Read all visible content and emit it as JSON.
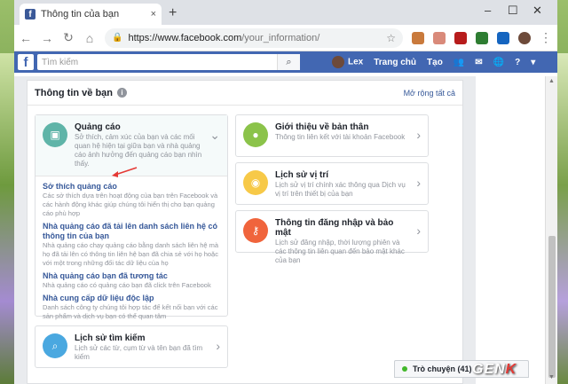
{
  "browser": {
    "tab_title": "Thông tin của bạn",
    "tab_close": "×",
    "new_tab": "+",
    "min": "–",
    "max": "☐",
    "close": "✕",
    "url_host": "https://www.facebook.com",
    "url_path": "/your_information/"
  },
  "fbbar": {
    "logo": "f",
    "search_placeholder": "Tìm kiếm",
    "user": "Lex",
    "home": "Trang chủ",
    "create": "Tạo"
  },
  "panel": {
    "title": "Thông tin về bạn",
    "expand_all": "Mở rộng tất cả"
  },
  "cards": {
    "ads": {
      "title": "Quảng cáo",
      "desc": "Sở thích, cảm xúc của bạn và các mối quan hệ hiện tại giữa bạn và nhà quảng cáo ảnh hưởng đến quảng cáo bạn nhìn thấy.",
      "subs": [
        {
          "link": "Sở thích quảng cáo",
          "desc": "Các sở thích dựa trên hoạt động của bạn trên Facebook và các hành động khác giúp chúng tôi hiển thị cho bạn quảng cáo phù hợp"
        },
        {
          "link": "Nhà quảng cáo đã tải lên danh sách liên hệ có thông tin của bạn",
          "desc": "Nhà quảng cáo chạy quảng cáo bằng danh sách liên hệ mà họ đã tải lên có thông tin liên hệ bạn đã chia sẻ với họ hoặc với một trong những đối tác dữ liệu của họ"
        },
        {
          "link": "Nhà quảng cáo bạn đã tương tác",
          "desc": "Nhà quảng cáo có quảng cáo bạn đã click trên Facebook"
        },
        {
          "link": "Nhà cung cấp dữ liệu độc lập",
          "desc": "Danh sách công ty chúng tôi hợp tác để kết nối bạn với các sản phẩm và dịch vụ bạn có thể quan tâm"
        }
      ]
    },
    "search": {
      "title": "Lịch sử tìm kiếm",
      "desc": "Lịch sử các từ, cụm từ và tên bạn đã tìm kiếm"
    },
    "about": {
      "title": "Giới thiệu về bản thân",
      "desc": "Thông tin liên kết với tài khoản Facebook"
    },
    "location": {
      "title": "Lịch sử vị trí",
      "desc": "Lịch sử vị trí chính xác thông qua Dịch vụ vị trí trên thiết bị của bạn"
    },
    "login": {
      "title": "Thông tin đăng nhập và bảo mật",
      "desc": "Lịch sử đăng nhập, thời lượng phiên và các thông tin liên quan đến bảo mật khác của bạn"
    }
  },
  "chat": {
    "label": "Trò chuyện (41)"
  },
  "watermark": {
    "text": "GENK",
    "accent": "K"
  },
  "colors": {
    "fb_blue": "#4267b2",
    "link": "#365899",
    "ads_green": "#5fb4a8",
    "about_green": "#8bc34a",
    "loc_yellow": "#f7c948",
    "login_orange": "#f0643c",
    "search_blue": "#4aa8e0"
  }
}
